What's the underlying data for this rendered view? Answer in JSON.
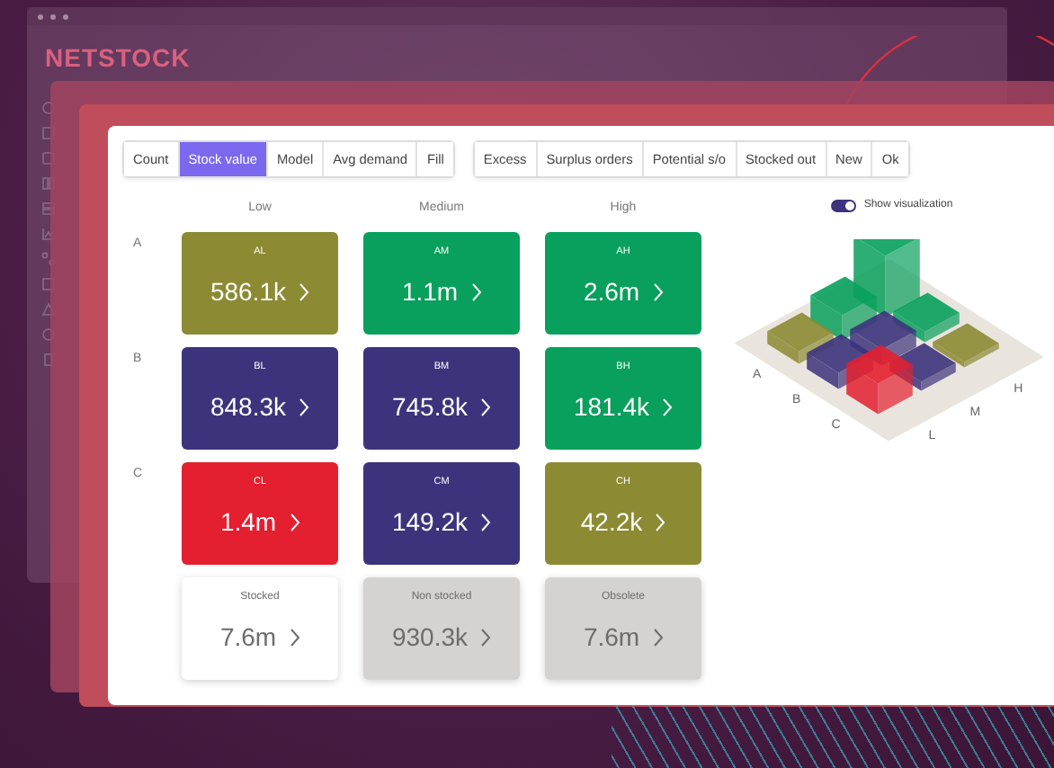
{
  "background_window": {
    "logo": "NETSTOCK"
  },
  "measure_tabs": [
    {
      "label": "Count",
      "selected": false
    },
    {
      "label": "Stock value",
      "selected": true
    },
    {
      "label": "Model",
      "selected": false
    },
    {
      "label": "Avg demand",
      "selected": false
    },
    {
      "label": "Fill",
      "selected": false
    }
  ],
  "filter_tabs": [
    {
      "label": "Excess"
    },
    {
      "label": "Surplus orders"
    },
    {
      "label": "Potential s/o"
    },
    {
      "label": "Stocked out"
    },
    {
      "label": "New"
    },
    {
      "label": "Ok"
    }
  ],
  "toggle": {
    "label": "Show visualization",
    "on": true
  },
  "columns": [
    "Low",
    "Medium",
    "High"
  ],
  "rows": [
    {
      "label": "A",
      "cells": [
        {
          "code": "AL",
          "value": "586.1k",
          "color": "#8c8a33"
        },
        {
          "code": "AM",
          "value": "1.1m",
          "color": "#08a05c"
        },
        {
          "code": "AH",
          "value": "2.6m",
          "color": "#08a05c"
        }
      ]
    },
    {
      "label": "B",
      "cells": [
        {
          "code": "BL",
          "value": "848.3k",
          "color": "#3d337c"
        },
        {
          "code": "BM",
          "value": "745.8k",
          "color": "#3d337c"
        },
        {
          "code": "BH",
          "value": "181.4k",
          "color": "#08a05c"
        }
      ]
    },
    {
      "label": "C",
      "cells": [
        {
          "code": "CL",
          "value": "1.4m",
          "color": "#e41f2f"
        },
        {
          "code": "CM",
          "value": "149.2k",
          "color": "#3d337c"
        },
        {
          "code": "CH",
          "value": "42.2k",
          "color": "#8c8a33"
        }
      ]
    }
  ],
  "summary": [
    {
      "label": "Stocked",
      "value": "7.6m",
      "color": "#ffffff"
    },
    {
      "label": "Non stocked",
      "value": "930.3k",
      "color": "#d5d3d1"
    },
    {
      "label": "Obsolete",
      "value": "7.6m",
      "color": "#d5d3d1"
    }
  ],
  "visualization": {
    "row_labels": [
      "A",
      "B",
      "C"
    ],
    "column_labels": [
      "L",
      "M",
      "H"
    ]
  }
}
